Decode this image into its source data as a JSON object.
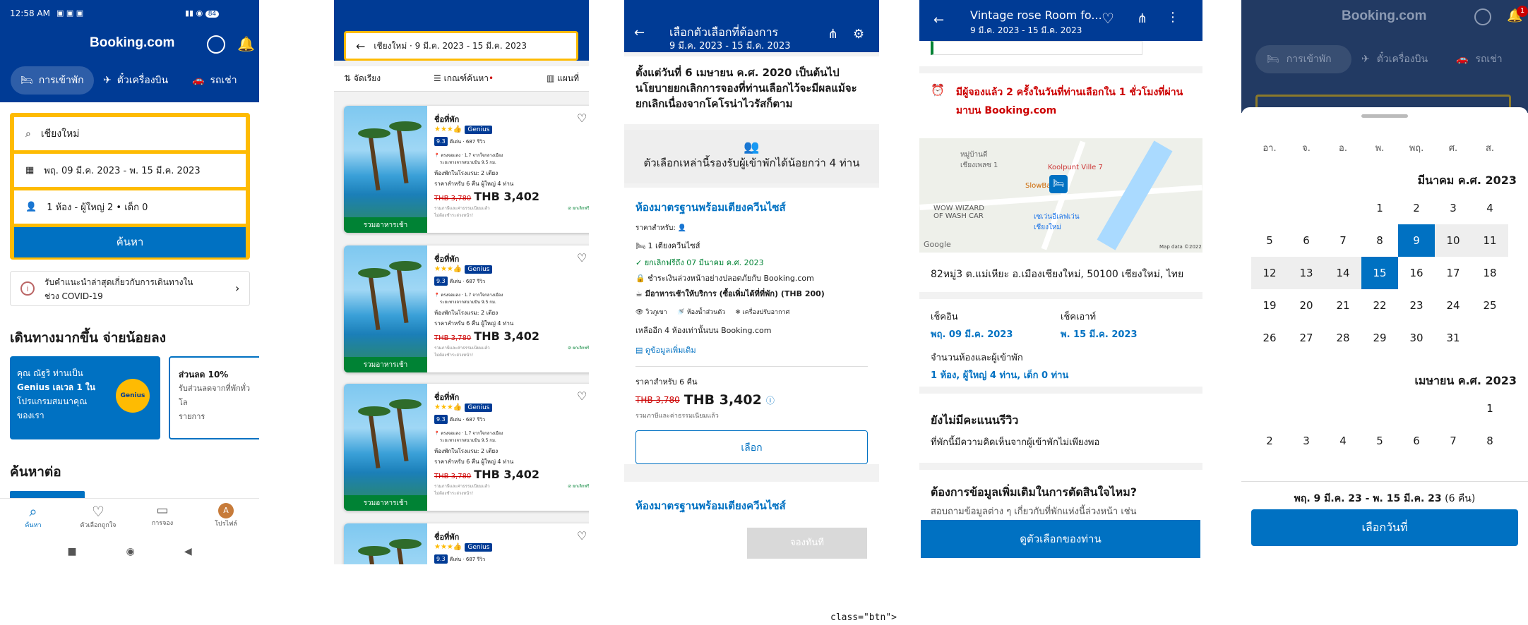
{
  "s1": {
    "status_time": "12:58 AM",
    "battery": "84",
    "brand": "Booking.com",
    "tabs": [
      "การเข้าพัก",
      "ตั๋วเครื่องบิน",
      "รถเช่า"
    ],
    "destination": "เชียงใหม่",
    "dates": "พฤ. 09 มี.ค. 2023 - พ. 15 มี.ค. 2023",
    "guests": "1 ห้อง - ผู้ใหญ่ 2 • เด็ก 0",
    "search_label": "ค้นหา",
    "covid_line1": "รับคำแนะนำล่าสุดเกี่ยวกับการเดินทางใน",
    "covid_line2": "ช่วง COVID-19",
    "section_title": "เดินทางมากขึ้น จ่ายน้อยลง",
    "promo1_line1": "คุณ ณัฐริ ท่านเป็น",
    "promo1_line2": "Genius เลเวล 1 ใน",
    "promo1_line3": "โปรแกรมสมนาคุณ",
    "promo1_line4": "ของเรา",
    "promo_badge": "Genius",
    "promo2_title": "ส่วนลด 10%",
    "promo2_line1": "รับส่วนลดจากที่พักทั่วโล",
    "promo2_line2": "รายการ",
    "continue_title": "ค้นหาต่อ",
    "nav": [
      "ค้นหา",
      "ตัวเลือกถูกใจ",
      "การจอง",
      "โปรไฟล์"
    ],
    "avatar_letter": "A"
  },
  "s2": {
    "search_summary": "เชียงใหม่ · 9 มี.ค. 2023 - 15 มี.ค. 2023",
    "sort": "จัดเรียง",
    "filter": "เกณฑ์ค้นหา",
    "map": "แผนที่",
    "card": {
      "name": "ชื่อที่พัก",
      "genius": "Genius",
      "score": "9.3",
      "reviews": "ดีเด่น · 687 รีวิว",
      "dist1": "ตรงจอแลง · 1.7 จากใจกลางเมือง",
      "dist2": "ระยะทางจากสนามบิน 9.5 กม.",
      "room_type": "ห้องพักในโรงแรม: 2 เตียง",
      "price_for": "ราคาสำหรับ 6 คืน ผู้ใหญ่ 4 ท่าน",
      "old_price": "THB 3,780",
      "price": "THB 3,402",
      "taxes": "รวมภาษีและค่าธรรมเนียมแล้ว",
      "free_cancel": "ยกเลิกฟรี",
      "no_prepay": "ไม่ต้องชำระล่วงหน้า!",
      "photo_tag": "รวมอาหารเช้า"
    }
  },
  "s3": {
    "title": "เลือกตัวเลือกที่ต้องการ",
    "dates": "9 มี.ค. 2023 - 15 มี.ค. 2023",
    "notice": "ตั้งแต่วันที่ 6 เมษายน ค.ศ. 2020 เป็นต้นไป นโยบายยกเลิกการจองที่ท่านเลือกไว้จะมีผลแม้จะยกเลิกเนื่องจากโคโรน่าไวรัสก็ตาม",
    "capacity": "ตัวเลือกเหล่านี้รองรับผู้เข้าพักได้น้อยกว่า 4 ท่าน",
    "room_title": "ห้องมาตรฐานพร้อมเตียงควีนไซส์",
    "price_for": "ราคาสำหรับ:",
    "bed": "1 เตียงควีนไซส์",
    "free_cancel": "ยกเลิกฟรีถึง 07 มีนาคม ค.ศ. 2023",
    "pay": "ชำระเงินล่วงหน้าอย่างปลอดภัยกับ Booking.com",
    "breakfast": "มีอาหารเช้าให้บริการ (ซื้อเพิ่มได้ที่ที่พัก) (THB 200)",
    "fac1": "วิวภูเขา",
    "fac2": "ห้องน้ำส่วนตัว",
    "fac3": "เครื่องปรับอากาศ",
    "left": "เหลืออีก 4 ห้องเท่านั้นบน Booking.com",
    "more": "ดูข้อมูลเพิ่มเติม",
    "nights": "ราคาสำหรับ 6 คืน",
    "old_price": "THB 3,780",
    "price": "THB 3,402",
    "taxes": "รวมภาษีและค่าธรรมเนียมแล้ว",
    "select": "เลือก",
    "room_title2": "ห้องมาตรฐานพร้อมเตียงควีนไซส์",
    "reserve": "จองทันที"
  },
  "s4": {
    "title": "Vintage rose Room fo...",
    "dates": "9 มี.ค. 2023 - 15 มี.ค. 2023",
    "urgency": "มีผู้จองแล้ว 2 ครั้งในวันที่ท่านเลือกใน 1 ชั่วโมงที่ผ่านมาบน Booking.com",
    "map_label1": "หมู่บ้านดี",
    "map_label1b": "เชียงเพลซ 1",
    "map_label2": "Koolpunt Ville 7",
    "map_label3": "SlowBar",
    "map_label4": "WOW WIZARD",
    "map_label4b": "OF WASH CAR",
    "map_label5": "เซเว่นอีเลฟเว่น",
    "map_label5b": "เชียงใหม่",
    "google": "Google",
    "mapdata": "Map data ©2022",
    "address": "82หมู่3 ต.แม่เหียะ อ.เมืองเชียงใหม่, 50100 เชียงใหม่, ไทย",
    "checkin_label": "เช็คอิน",
    "checkin": "พฤ. 09 มี.ค. 2023",
    "checkout_label": "เช็คเอาท์",
    "checkout": "พ. 15 มี.ค. 2023",
    "rooms_label": "จำนวนห้องและผู้เข้าพัก",
    "rooms": "1 ห้อง, ผู้ใหญ่ 4 ท่าน, เด็ก 0 ท่าน",
    "review_title": "ยังไม่มีคะแนนรีวิว",
    "review_text": "ที่พักนี้มีความคิดเห็นจากผู้เข้าพักไม่เพียงพอ",
    "more_title": "ต้องการข้อมูลเพิ่มเติมในการตัดสินใจไหม?",
    "more_text": "สอบถามข้อมูลต่าง ๆ เกี่ยวกับที่พักแห่งนี้ล่วงหน้า เช่น",
    "cta": "ดูตัวเลือกของท่าน"
  },
  "s5": {
    "brand": "Booking.com",
    "tabs": [
      "การเข้าพัก",
      "ตั๋วเครื่องบิน",
      "รถเช่า"
    ],
    "weekdays": [
      "อา.",
      "จ.",
      "อ.",
      "พ.",
      "พฤ.",
      "ศ.",
      "ส."
    ],
    "month1": "มีนาคม ค.ศ. 2023",
    "month2": "เมษายน ค.ศ. 2023",
    "range": "พฤ. 9 มี.ค. 23 - พ. 15 มี.ค. 23",
    "nights": "(6 คืน)",
    "cta": "เลือกวันที่",
    "notif": "1"
  },
  "stray_text": "class=\"btn\">",
  "colors": {
    "brand_blue": "#003b95",
    "action_blue": "#0071c2",
    "yellow": "#febb02",
    "green": "#008234",
    "red": "#cc0000"
  }
}
